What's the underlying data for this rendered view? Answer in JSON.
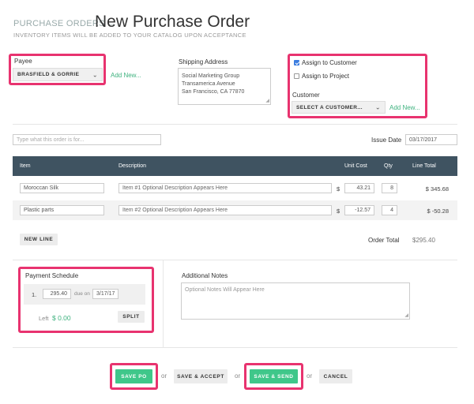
{
  "header": {
    "breadcrumb": "PURCHASE ORDERS",
    "arrow": "→",
    "title": "New Purchase Order",
    "subtitle": "INVENTORY ITEMS WILL BE ADDED TO YOUR CATALOG UPON ACCEPTANCE"
  },
  "payee": {
    "label": "Payee",
    "selected": "BRASFIELD & GORRIE",
    "add_new": "Add New..."
  },
  "shipping": {
    "label": "Shipping Address",
    "lines": [
      "Social Marketing Group",
      "Transamerica Avenue",
      "San Francisco, CA  77870"
    ]
  },
  "assign": {
    "customer_label": "Assign to Customer",
    "customer_checked": true,
    "project_label": "Assign to Project",
    "project_checked": false,
    "customer_field_label": "Customer",
    "customer_select": "SELECT A CUSTOMER...",
    "add_new": "Add New..."
  },
  "order_for": {
    "placeholder": "Type what this order is for..."
  },
  "issue_date": {
    "label": "Issue Date",
    "value": "03/17/2017"
  },
  "table": {
    "columns": {
      "item": "Item",
      "description": "Description",
      "unit_cost": "Unit Cost",
      "qty": "Qty",
      "line_total": "Line Total"
    },
    "rows": [
      {
        "item": "Moroccan Silk",
        "description": "Item #1 Optional Description Appears Here",
        "currency": "$",
        "unit_cost": "43.21",
        "qty": "8",
        "line_total": "$ 345.68"
      },
      {
        "item": "Plastic parts",
        "description": "Item #2 Optional Description Appears Here",
        "currency": "$",
        "unit_cost": "-12.57",
        "qty": "4",
        "line_total": "$ -50.28"
      }
    ],
    "new_line": "NEW LINE",
    "order_total_label": "Order Total",
    "order_total_value": "$295.40"
  },
  "payment": {
    "label": "Payment Schedule",
    "index": "1.",
    "amount": "295.40",
    "due_on": "due on",
    "date": "3/17/17",
    "left_label": "Left",
    "left_value": "$ 0.00",
    "split": "SPLIT"
  },
  "notes": {
    "label": "Additional Notes",
    "placeholder": "Optional Notes Will Appear Here"
  },
  "actions": {
    "save_po": "SAVE PO",
    "save_accept": "SAVE & ACCEPT",
    "save_send": "SAVE & SEND",
    "cancel": "CANCEL",
    "or": "or"
  },
  "colors": {
    "accent_green": "#3fc78a",
    "highlight": "#e8336f",
    "table_header": "#3f5361"
  }
}
